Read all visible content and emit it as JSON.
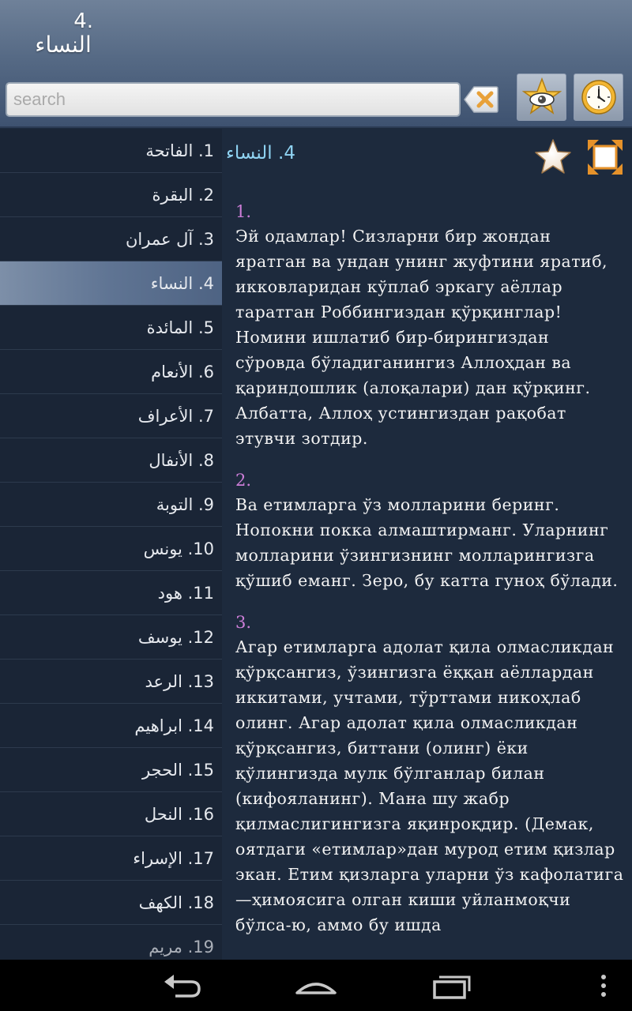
{
  "header": {
    "sura_number": "4.",
    "sura_name": "النساء"
  },
  "search": {
    "placeholder": "search",
    "value": ""
  },
  "suras": [
    {
      "label": "1. الفاتحة",
      "active": false
    },
    {
      "label": "2. البقرة",
      "active": false
    },
    {
      "label": "3. آل عمران",
      "active": false
    },
    {
      "label": "4. النساء",
      "active": true
    },
    {
      "label": "5. المائدة",
      "active": false
    },
    {
      "label": "6. الأنعام",
      "active": false
    },
    {
      "label": "7. الأعراف",
      "active": false
    },
    {
      "label": "8. الأنفال",
      "active": false
    },
    {
      "label": "9. التوبة",
      "active": false
    },
    {
      "label": "10. يونس",
      "active": false
    },
    {
      "label": "11. هود",
      "active": false
    },
    {
      "label": "12. يوسف",
      "active": false
    },
    {
      "label": "13. الرعد",
      "active": false
    },
    {
      "label": "14. ابراهيم",
      "active": false
    },
    {
      "label": "15. الحجر",
      "active": false
    },
    {
      "label": "16. النحل",
      "active": false
    },
    {
      "label": "17. الإسراء",
      "active": false
    },
    {
      "label": "18. الكهف",
      "active": false
    },
    {
      "label": "19. مريم",
      "active": false
    }
  ],
  "content": {
    "title": "4. النساء",
    "verses": [
      {
        "number": "1.",
        "text": "Эй одамлар! Сизларни бир жондан яратган ва ундан унинг жуфтини яратиб, икковларидан кўплаб эркагу аёллар таратган Роббингиздан қўрқинглар! Номини ишлатиб бир-бирингиздан сўровда бўладиганингиз Аллоҳдан ва қариндошлик (алоқалари) дан қўрқинг. Албатта, Аллоҳ устингиздан рақобат этувчи зотдир."
      },
      {
        "number": "2.",
        "text": "Ва етимларга ўз молларини беринг. Нопокни покка алмаштирманг. Уларнинг молларини ўзингизнинг молларингизга қўшиб еманг. Зеро, бу катта гуноҳ бўлади."
      },
      {
        "number": "3.",
        "text": "Агар етимларга адолат қила олмасликдан қўрқсангиз, ўзингизга ёққан аёллардан иккитами, учтами, тўрттами никоҳлаб олинг. Агар адолат қила олмасликдан қўрқсангиз, биттани (олинг) ёки қўлингизда мулк бўлганлар билан (кифояланинг). Мана шу жабр қилмаслигингизга яқинроқдир. (Демак, оятдаги «етимлар»дан мурод етим қизлар экан. Етим қизларга уларни ўз кафолатига—ҳимоясига олган киши уйланмоқчи бўлса-ю, аммо бу ишда"
      }
    ]
  },
  "colors": {
    "verse_number": "#cc7ed8",
    "content_title": "#8fd3f2",
    "active_item": "#5f7493",
    "background": "#1d2a3d"
  },
  "icons": {
    "clear": "clear-search-icon",
    "view": "eye-star-icon",
    "history": "clock-icon",
    "favorite": "star-icon",
    "fullscreen": "fullscreen-icon",
    "back": "back-arrow-icon",
    "home": "home-icon",
    "recent": "recent-apps-icon",
    "menu": "overflow-menu-icon"
  }
}
